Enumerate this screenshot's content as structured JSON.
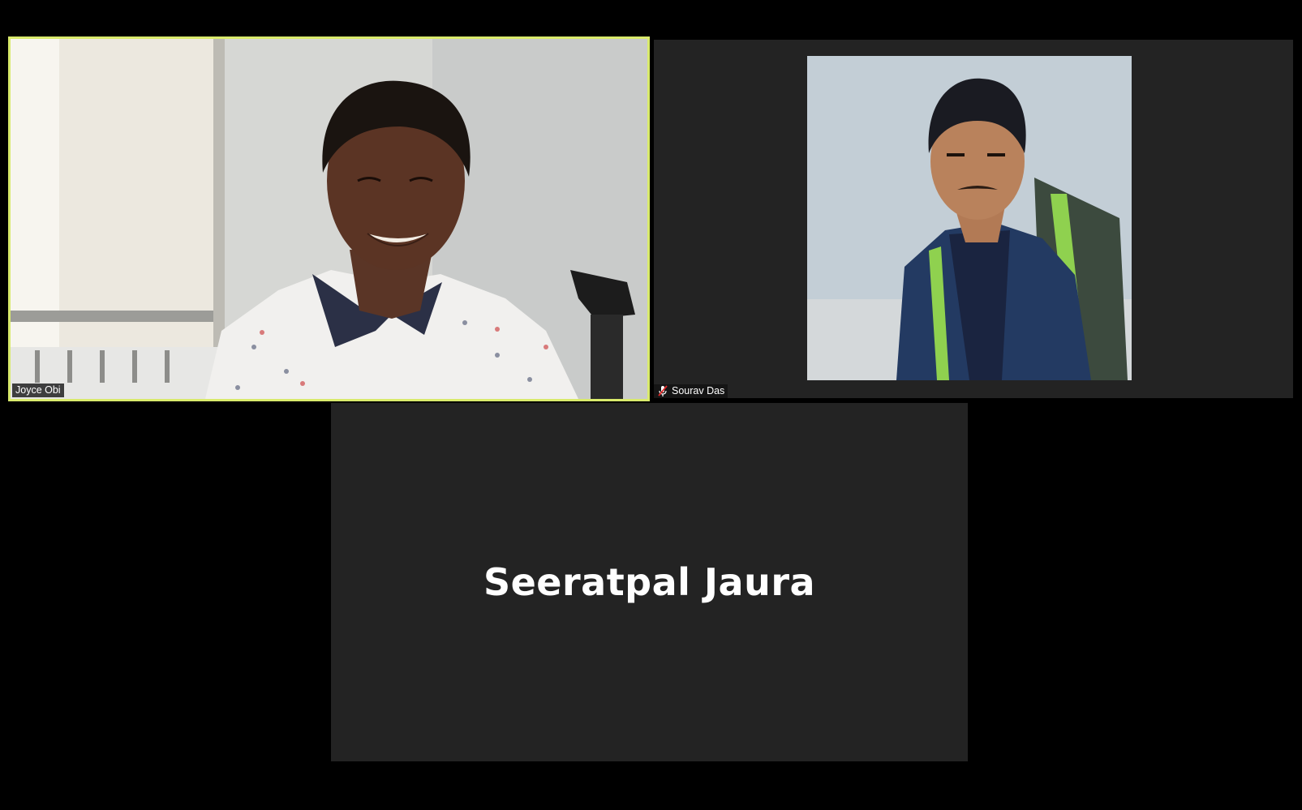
{
  "participants": [
    {
      "name": "Joyce Obi",
      "state": "video-on",
      "active_speaker": true
    },
    {
      "name": "Sourav Das",
      "state": "profile-picture",
      "muted": true
    },
    {
      "name": "Seeratpal Jaura",
      "state": "video-off"
    }
  ],
  "colors": {
    "active_speaker_border": "#d9ea6c",
    "tile_background": "#232323",
    "page_background": "#000000",
    "muted_mic": "#e02828"
  },
  "icons": {
    "muted": "microphone-muted-icon"
  }
}
